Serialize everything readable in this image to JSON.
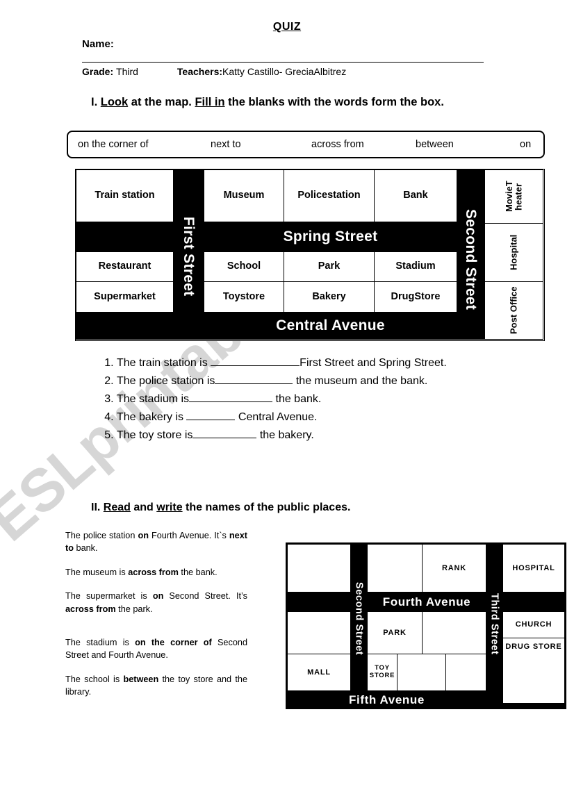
{
  "header": {
    "title": "QUIZ",
    "name_label": "Name:",
    "grade_label": "Grade:",
    "grade_value": "Third",
    "teachers_label": "Teachers:",
    "teachers_value": "Katty Castillo- GreciaAlbitrez"
  },
  "watermark": {
    "text": "ESLprintables.com"
  },
  "section1": {
    "instruction_line1_a": "I. ",
    "instruction_look": "Look",
    "instruction_line1_b": " at the map. ",
    "instruction_fillin": "Fill in",
    "instruction_line1_c": " the blanks with the words form the box.",
    "word_box": [
      "on the corner of",
      "next to",
      "across from",
      "between",
      "on"
    ],
    "questions": [
      {
        "n": "1.",
        "before": "The train station is ",
        "after": "First Street and Spring Street."
      },
      {
        "n": "2.",
        "before": "The police station is",
        "after": " the museum and the bank."
      },
      {
        "n": "3.",
        "before": "The stadium is",
        "after": " the bank."
      },
      {
        "n": "4.",
        "before": "The bakery is ",
        "after": " Central Avenue."
      },
      {
        "n": "5.",
        "before": "The toy store is",
        "after": " the bakery."
      }
    ]
  },
  "map1": {
    "streets": {
      "first_street": "First Street",
      "second_street": "Second Street",
      "spring_street": "Spring Street",
      "central_avenue": "Central Avenue"
    },
    "blocks": {
      "train_station": "Train station",
      "restaurant": "Restaurant",
      "supermarket": "Supermarket",
      "museum": "Museum",
      "police_station": "Policestation",
      "bank": "Bank",
      "school": "School",
      "park": "Park",
      "stadium": "Stadium",
      "toystore": "Toystore",
      "bakery": "Bakery",
      "drugstore": "DrugStore",
      "movie_theater": "MovieT heater",
      "hospital": "Hospital",
      "post_office": "Post Office"
    }
  },
  "section2": {
    "instruction_a": "II. ",
    "instruction_read": "Read",
    "instruction_b": " and ",
    "instruction_write": "write",
    "instruction_c": " the names of the public places.",
    "paragraphs": [
      {
        "parts": [
          {
            "t": "The police station ",
            "b": false
          },
          {
            "t": "on",
            "b": true
          },
          {
            "t": " Fourth Avenue. It`s ",
            "b": false
          },
          {
            "t": "next to",
            "b": true
          },
          {
            "t": " bank.",
            "b": false
          }
        ]
      },
      {
        "parts": [
          {
            "t": "The museum is ",
            "b": false
          },
          {
            "t": "across from",
            "b": true
          },
          {
            "t": " the bank.",
            "b": false
          }
        ]
      },
      {
        "parts": [
          {
            "t": "The supermarket is ",
            "b": false
          },
          {
            "t": "on",
            "b": true
          },
          {
            "t": " Second Street. It’s ",
            "b": false
          },
          {
            "t": "across from",
            "b": true
          },
          {
            "t": " the park.",
            "b": false
          }
        ]
      },
      {
        "parts": [
          {
            "t": "The stadium is ",
            "b": false
          },
          {
            "t": "on the corner of",
            "b": true
          },
          {
            "t": " Second Street and Fourth Avenue.",
            "b": false
          }
        ]
      },
      {
        "parts": [
          {
            "t": "The school is ",
            "b": false
          },
          {
            "t": "between",
            "b": true
          },
          {
            "t": " the toy store and the library.",
            "b": false
          }
        ]
      }
    ]
  },
  "map2": {
    "streets": {
      "second_street": "Second Street",
      "third_street": "Third Street",
      "fourth_avenue": "Fourth Avenue",
      "fifth_avenue": "Fifth Avenue"
    },
    "blocks": {
      "bank": "RANK",
      "hospital": "HOSPITAL",
      "park": "PARK",
      "church": "CHURCH",
      "drug_store": "DRUG STORE",
      "mall": "MALL",
      "toy_store": "TOY STORE"
    }
  }
}
